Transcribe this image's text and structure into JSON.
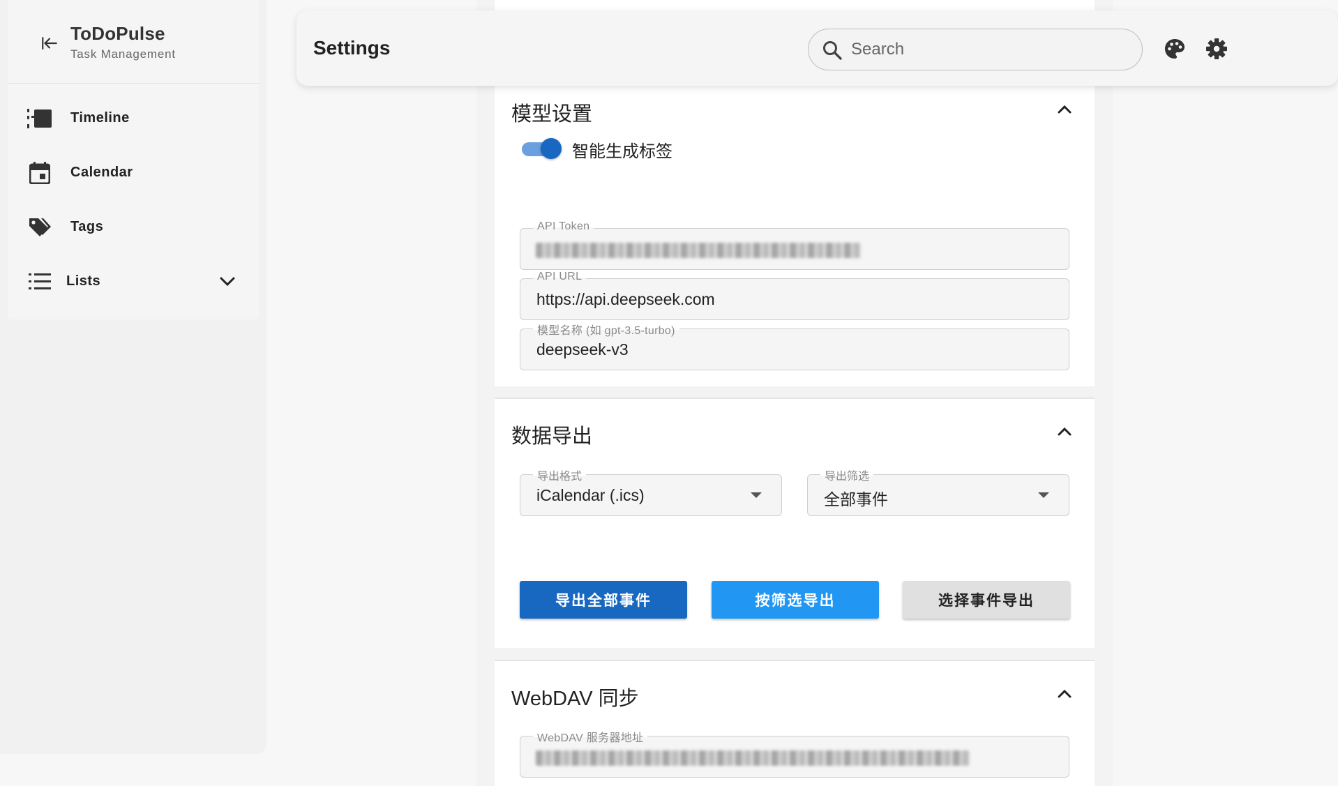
{
  "app": {
    "name": "ToDoPulse",
    "subtitle": "Task Management"
  },
  "sidebar": {
    "items": [
      {
        "label": "Timeline",
        "icon": "timeline-icon"
      },
      {
        "label": "Calendar",
        "icon": "calendar-icon"
      },
      {
        "label": "Tags",
        "icon": "tags-icon"
      },
      {
        "label": "Lists",
        "icon": "list-icon",
        "expandable": true
      }
    ]
  },
  "header": {
    "title": "Settings",
    "search_placeholder": "Search",
    "icons": [
      "palette-icon",
      "gear-icon"
    ]
  },
  "model_settings": {
    "title": "模型设置",
    "toggle_label": "智能生成标签",
    "toggle_on": true,
    "api_token_label": "API Token",
    "api_token_value": "",
    "api_url_label": "API URL",
    "api_url_value": "https://api.deepseek.com",
    "model_name_label": "模型名称 (如 gpt-3.5-turbo)",
    "model_name_value": "deepseek-v3"
  },
  "data_export": {
    "title": "数据导出",
    "format_label": "导出格式",
    "format_value": "iCalendar (.ics)",
    "filter_label": "导出筛选",
    "filter_value": "全部事件",
    "buttons": {
      "export_all": "导出全部事件",
      "export_filtered": "按筛选导出",
      "export_selected": "选择事件导出"
    }
  },
  "webdav": {
    "title": "WebDAV 同步",
    "server_label": "WebDAV 服务器地址",
    "server_value": ""
  },
  "colors": {
    "primary": "#1867c0",
    "info": "#2196f3",
    "toggle_track": "#6a9fe0"
  }
}
